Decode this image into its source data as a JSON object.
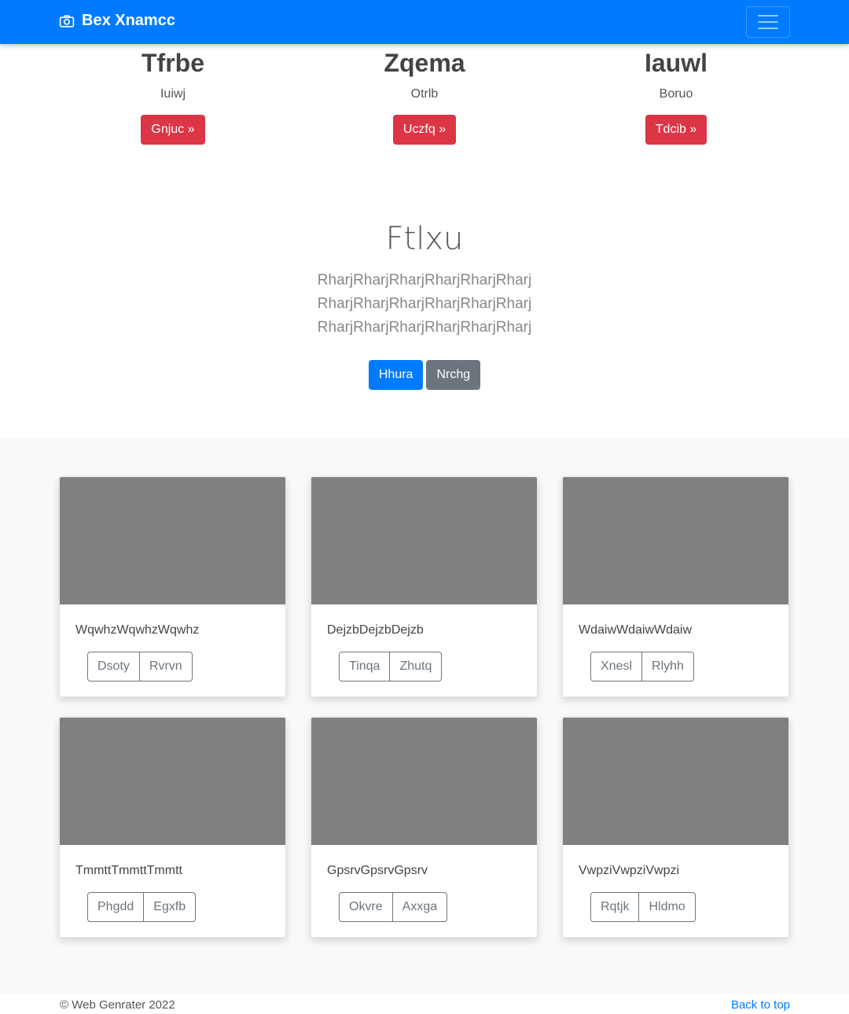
{
  "nav": {
    "brand": "Bex Xnamcc"
  },
  "features": [
    {
      "title": "Tfrbe",
      "text": "Iuiwj",
      "button": "Gnjuc »"
    },
    {
      "title": "Zqema",
      "text": "Otrlb",
      "button": "Uczfq »"
    },
    {
      "title": "Iauwl",
      "text": "Boruo",
      "button": "Tdcib »"
    }
  ],
  "hero": {
    "title": "Ftlxu",
    "lead": "RharjRharjRharjRharjRharjRharj RharjRharjRharjRharjRharjRharj RharjRharjRharjRharjRharjRharj",
    "primary": "Hhura",
    "secondary": "Nrchg"
  },
  "cards": [
    {
      "text": "WqwhzWqwhzWqwhz",
      "btn1": "Dsoty",
      "btn2": "Rvrvn"
    },
    {
      "text": "DejzbDejzbDejzb",
      "btn1": "Tinqa",
      "btn2": "Zhutq"
    },
    {
      "text": "WdaiwWdaiwWdaiw",
      "btn1": "Xnesl",
      "btn2": "Rlyhh"
    },
    {
      "text": "TmmttTmmttTmmtt",
      "btn1": "Phgdd",
      "btn2": "Egxfb"
    },
    {
      "text": "GpsrvGpsrvGpsrv",
      "btn1": "Okvre",
      "btn2": "Axxga"
    },
    {
      "text": "VwpziVwpziVwpzi",
      "btn1": "Rqtjk",
      "btn2": "Hldmo"
    }
  ],
  "footer": {
    "copyright": "© Web Genrater 2022",
    "back_to_top": "Back to top"
  },
  "colors": {
    "primary": "#007bff",
    "danger": "#dc3545",
    "secondary": "#6c757d",
    "thumb": "#808080"
  },
  "icons": {
    "brand": "camera-icon",
    "toggler": "hamburger-icon"
  }
}
